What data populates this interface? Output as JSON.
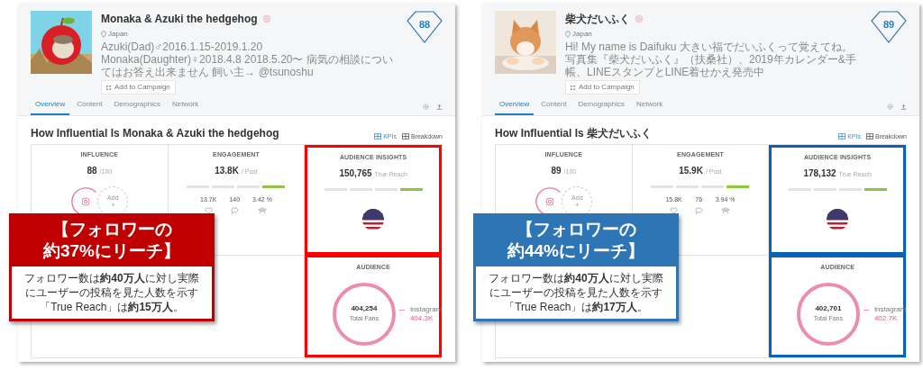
{
  "panels": [
    {
      "color": "#ff0000",
      "profile": {
        "name": "Monaka & Azuki the hedgehog",
        "location": "Japan",
        "bio": "Azuki(Dad)♂2016.1.15-2019.1.20 Monaka(Daughter)♀2018.4.8 2018.5.20〜 病気の相談についてはお答え出来ません 飼い主→ @tsunoshu",
        "add_button": "Add to Campaign",
        "score": "88"
      },
      "tabs": [
        {
          "label": "Overview",
          "selected": true
        },
        {
          "label": "Content",
          "selected": false
        },
        {
          "label": "Demographics",
          "selected": false
        },
        {
          "label": "Network",
          "selected": false
        }
      ],
      "section_title": "How Influential Is Monaka & Azuki the hedgehog",
      "views": [
        {
          "label": "KPIs",
          "selected": true
        },
        {
          "label": "Breakdown",
          "selected": false
        }
      ],
      "influence": {
        "title": "INFLUENCE",
        "value": "88",
        "unit": "/100",
        "add_label": "Add",
        "add_sign": "+"
      },
      "engagement": {
        "title": "ENGAGEMENT",
        "value": "13.8K",
        "unit": "/ Post",
        "segments": [
          {
            "active": false
          },
          {
            "active": false
          },
          {
            "active": false
          },
          {
            "active": true
          }
        ],
        "stats": [
          {
            "kind": "likes",
            "value": "13.7K"
          },
          {
            "kind": "comments",
            "value": "140"
          },
          {
            "kind": "rate",
            "value": "3.42 %"
          }
        ]
      },
      "audience_insights": {
        "title": "AUDIENCE INSIGHTS",
        "value": "150,765",
        "unit": "True Reach",
        "segments": [
          {
            "active": false
          },
          {
            "active": false
          },
          {
            "active": false
          },
          {
            "active": true
          }
        ],
        "highlighted": true
      },
      "audience": {
        "title": "AUDIENCE",
        "total": "404,254",
        "total_label": "Total Fans",
        "legend": [
          {
            "label": "Instagram",
            "value": "404.3K"
          }
        ],
        "highlighted": true
      },
      "callout": {
        "color": "#c00000",
        "title_lines": [
          "【フォロワーの",
          "約37%にリーチ】"
        ],
        "body": "フォロワー数は**約40万人**に対し実際にユーザーの投稿を見た人数を示す「True Reach」は**約15万人**。"
      }
    },
    {
      "color": "#0a62b8",
      "profile": {
        "name": "柴犬だいふく",
        "location": "Japan",
        "bio": "Hi! My name is Daifuku 大きい福でだいふくって覚えてね。写真集『柴犬だいふく』（扶桑社）、2019年カレンダー&手帳、LINEスタンプとLINE着せかえ発売中",
        "add_button": "Add to Campaign",
        "score": "89"
      },
      "tabs": [
        {
          "label": "Overview",
          "selected": true
        },
        {
          "label": "Content",
          "selected": false
        },
        {
          "label": "Demographics",
          "selected": false
        },
        {
          "label": "Network",
          "selected": false
        }
      ],
      "section_title": "How Influential Is 柴犬だいふく",
      "views": [
        {
          "label": "KPIs",
          "selected": true
        },
        {
          "label": "Breakdown",
          "selected": false
        }
      ],
      "influence": {
        "title": "INFLUENCE",
        "value": "89",
        "unit": "/100",
        "add_label": "Add",
        "add_sign": "+"
      },
      "engagement": {
        "title": "ENGAGEMENT",
        "value": "15.9K",
        "unit": "/ Post",
        "segments": [
          {
            "active": false
          },
          {
            "active": false
          },
          {
            "active": false
          },
          {
            "active": true
          }
        ],
        "stats": [
          {
            "kind": "likes",
            "value": "15.8K"
          },
          {
            "kind": "comments",
            "value": "76"
          },
          {
            "kind": "rate",
            "value": "3.94 %"
          }
        ]
      },
      "audience_insights": {
        "title": "AUDIENCE INSIGHTS",
        "value": "178,132",
        "unit": "True Reach",
        "segments": [
          {
            "active": false
          },
          {
            "active": false
          },
          {
            "active": false
          },
          {
            "active": true
          }
        ],
        "highlighted": true
      },
      "audience": {
        "title": "AUDIENCE",
        "total": "402,701",
        "total_label": "Total Fans",
        "legend": [
          {
            "label": "Instagram",
            "value": "402.7K"
          }
        ],
        "highlighted": true
      },
      "callout": {
        "color": "#2e75b6",
        "title_lines": [
          "【フォロワーの",
          "約44%にリーチ】"
        ],
        "body": "フォロワー数は**約40万人**に対し実際にユーザーの投稿を見た人数を示す「True Reach」は**約17万人**。"
      }
    }
  ]
}
